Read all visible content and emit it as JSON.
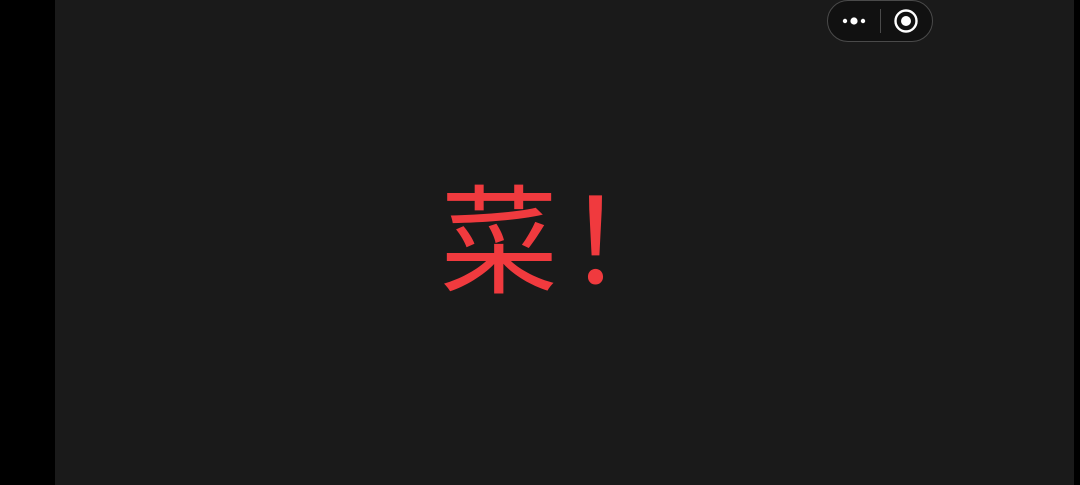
{
  "message": {
    "text": "菜！",
    "color": "#f03a3e"
  },
  "capsule": {
    "more_icon": "more-dots-icon",
    "close_icon": "target-close-icon"
  },
  "colors": {
    "background": "#1a1a1a",
    "letterbox": "#000000",
    "capsule_border": "#4a4a4a"
  }
}
